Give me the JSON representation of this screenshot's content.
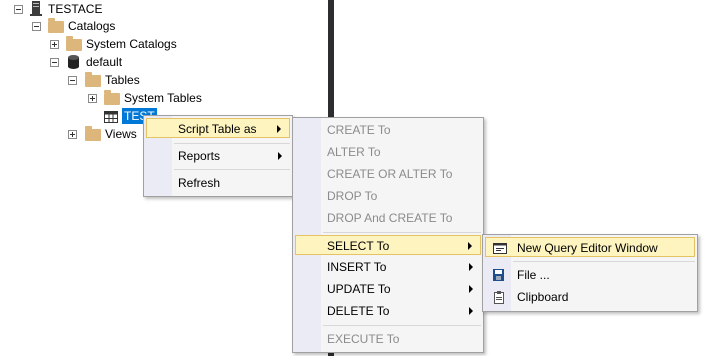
{
  "tree": {
    "server": "TESTACE",
    "catalogs": "Catalogs",
    "system_catalogs": "System Catalogs",
    "default": "default",
    "tables": "Tables",
    "system_tables": "System Tables",
    "test_table": "TEST",
    "views": "Views"
  },
  "context_menu": {
    "script_table_as": "Script Table as",
    "reports": "Reports",
    "refresh": "Refresh"
  },
  "script_submenu": {
    "create_to": "CREATE To",
    "alter_to": "ALTER To",
    "create_or_alter_to": "CREATE OR ALTER To",
    "drop_to": "DROP To",
    "drop_and_create_to": "DROP And CREATE To",
    "select_to": "SELECT To",
    "insert_to": "INSERT To",
    "update_to": "UPDATE To",
    "delete_to": "DELETE To",
    "execute_to": "EXECUTE To"
  },
  "select_submenu": {
    "new_query_editor_window": "New Query Editor Window",
    "file": "File ...",
    "clipboard": "Clipboard"
  },
  "colors": {
    "highlight_bg": "#fdf4bf",
    "highlight_border": "#e5c365",
    "folder": "#dcb67a",
    "splitter": "#2d2d30"
  }
}
